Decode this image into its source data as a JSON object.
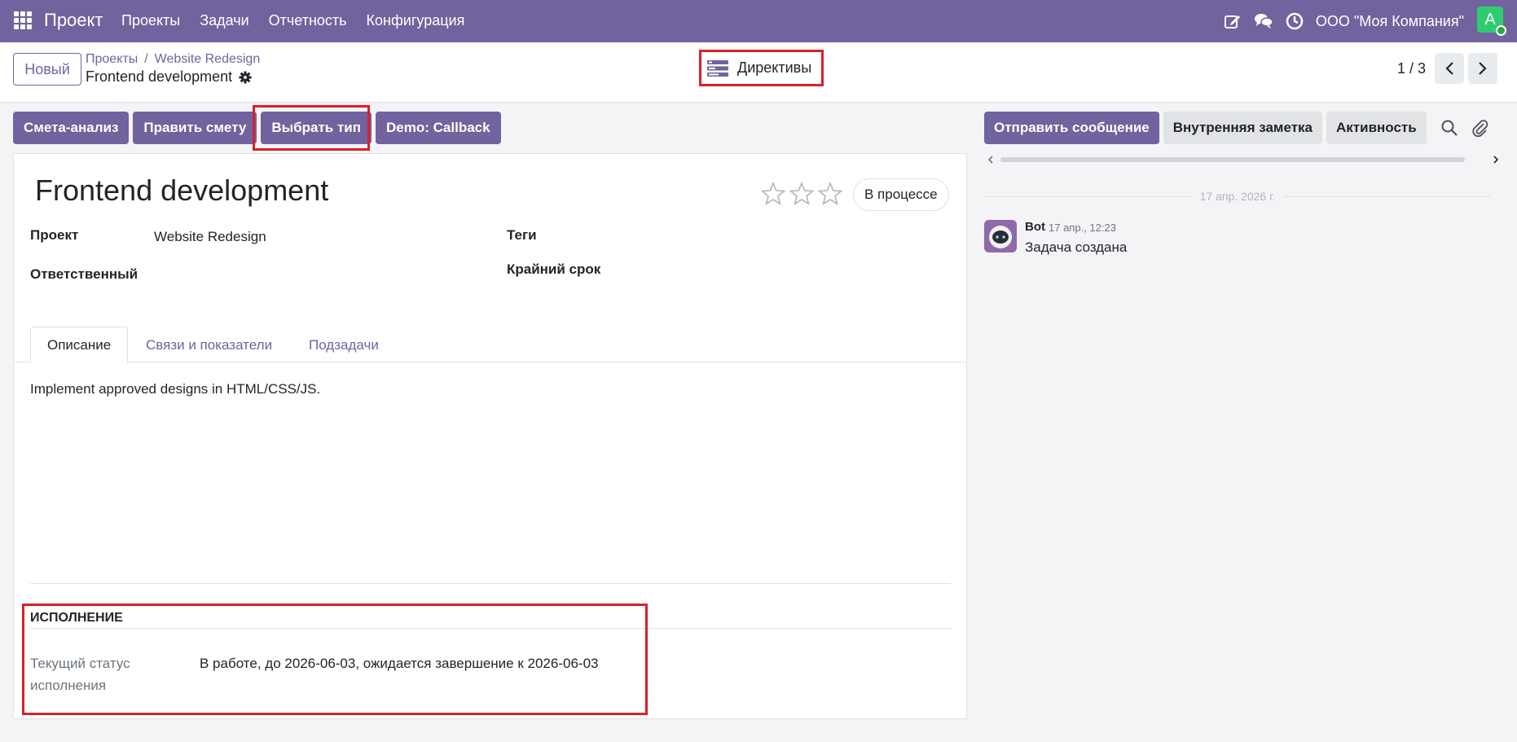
{
  "navbar": {
    "brand": "Проект",
    "menu": [
      "Проекты",
      "Задачи",
      "Отчетность",
      "Конфигурация"
    ],
    "company": "ООО \"Моя Компания\"",
    "avatar_letter": "A",
    "icons": [
      "apps-icon",
      "edit-icon",
      "chat-icon",
      "clock-icon"
    ]
  },
  "control": {
    "new_button": "Новый",
    "breadcrumb": [
      "Проекты",
      "Website Redesign"
    ],
    "breadcrumb_sep": "/",
    "record_title": "Frontend development",
    "directives_label": "Директивы",
    "pager": "1 / 3"
  },
  "actions": [
    "Смета-анализ",
    "Править смету",
    "Выбрать тип",
    "Demo: Callback"
  ],
  "form": {
    "name": "Frontend development",
    "stage": "В процессе",
    "priority_stars": 0,
    "fields": {
      "project_label": "Проект",
      "project_value": "Website Redesign",
      "user_label": "Ответственный",
      "tags_label": "Теги",
      "deadline_label": "Крайний срок"
    },
    "tabs": [
      "Описание",
      "Связи и показатели",
      "Подзадачи"
    ],
    "active_tab": 0,
    "description": "Implement approved designs in HTML/CSS/JS.",
    "execution": {
      "title": "ИСПОЛНЕНИЕ",
      "status_label": "Текущий статус исполнения",
      "status_value": "В работе, до 2026-06-03, ожидается завершение к 2026-06-03"
    }
  },
  "chatter": {
    "buttons": [
      "Отправить сообщение",
      "Внутренняя заметка",
      "Активность"
    ],
    "date": "17 апр. 2026 г.",
    "message": {
      "author": "Bot",
      "time": "17 апр., 12:23",
      "body": "Задача создана"
    }
  },
  "colors": {
    "brand": "#71639e",
    "highlight": "#d9202a",
    "avatar": "#2ecc71"
  }
}
